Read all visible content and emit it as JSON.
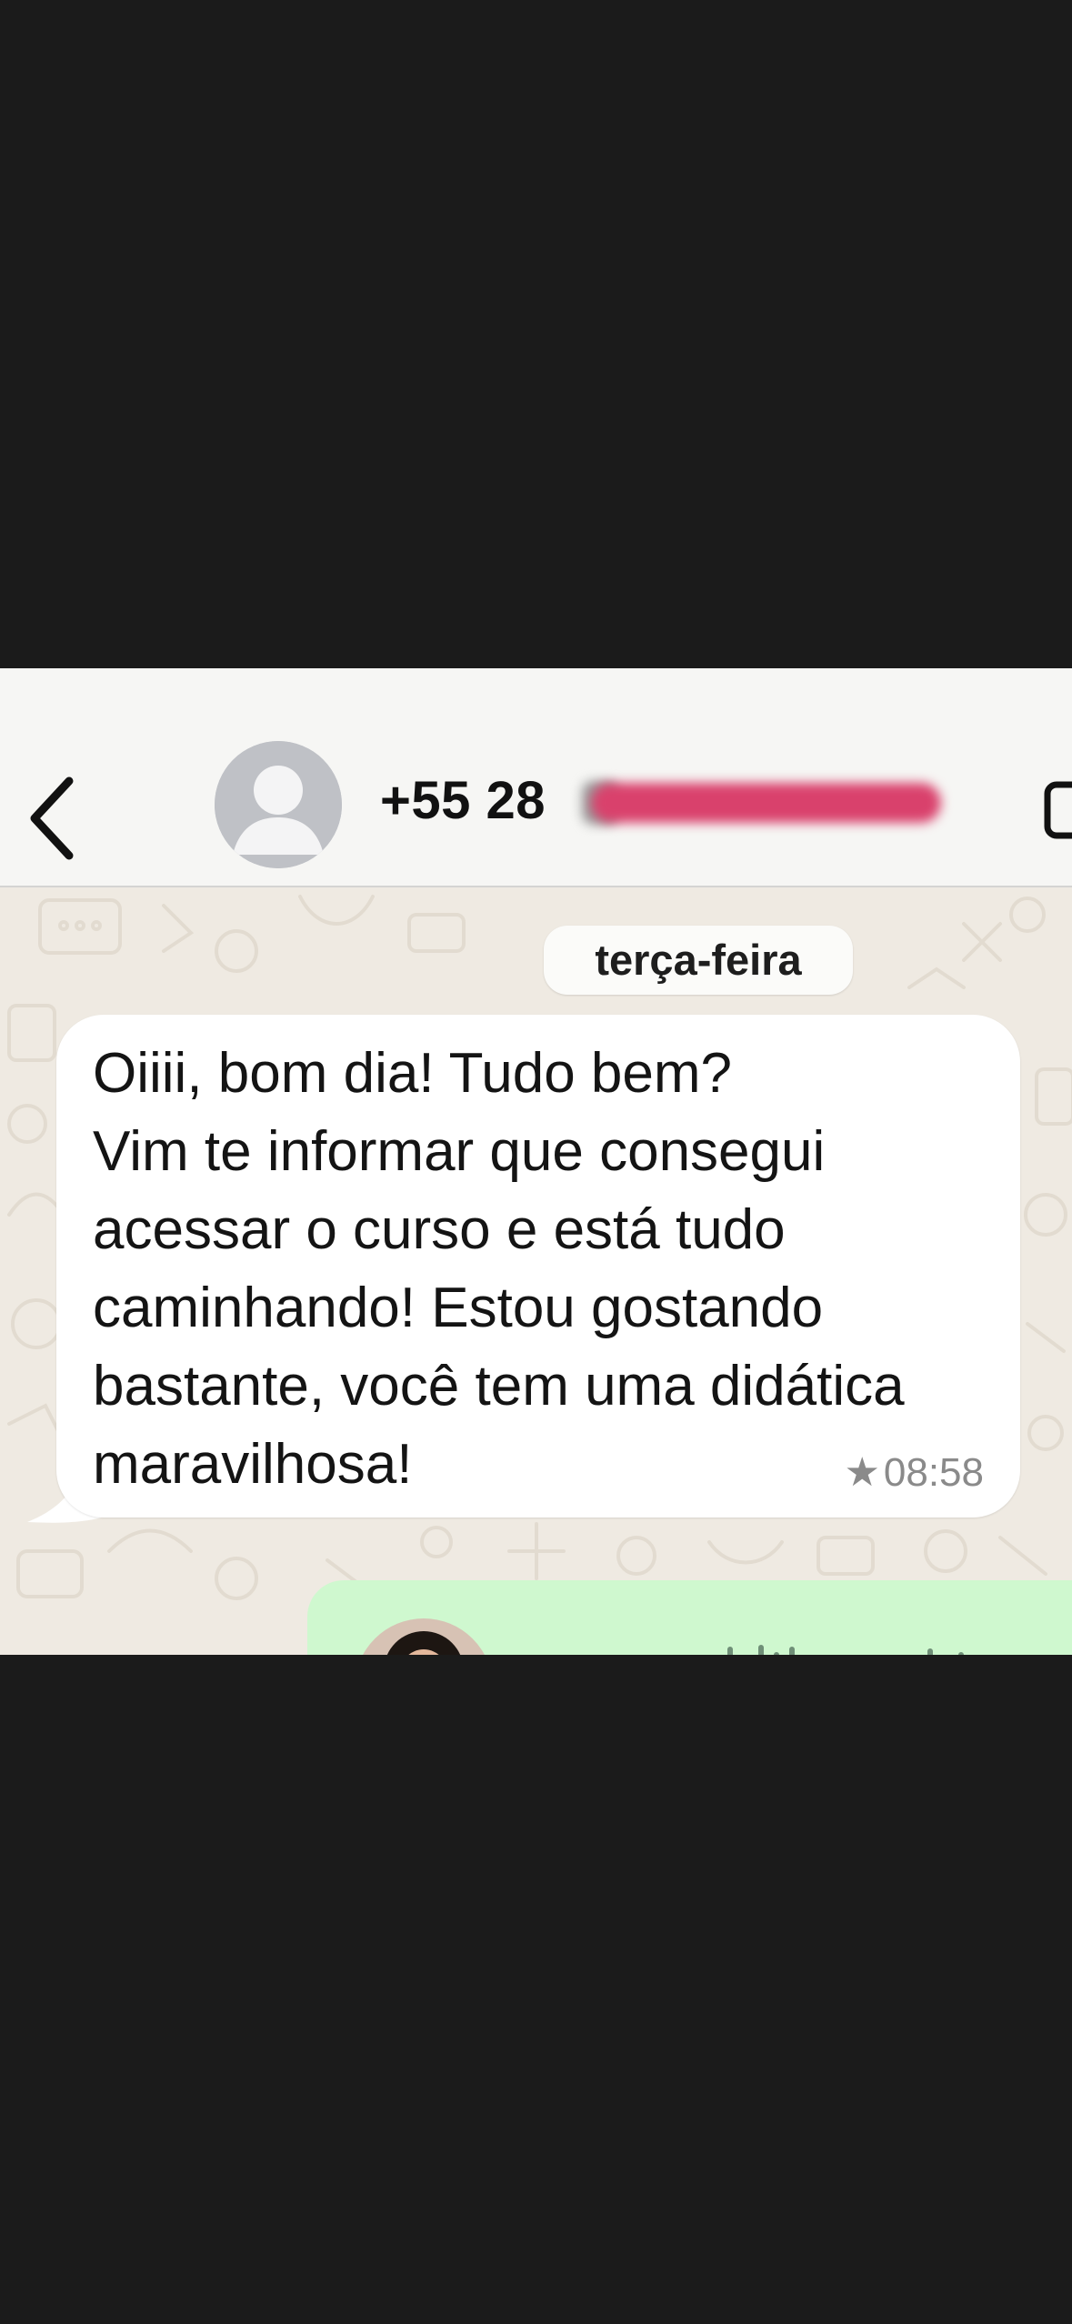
{
  "header": {
    "back_icon": "chevron-left-icon",
    "avatar_icon": "default-contact-avatar",
    "phone_number": "+55 28",
    "video_icon": "video-call-icon"
  },
  "chat": {
    "date_separator": "terça-feira",
    "message": {
      "text": "Oiiii, bom dia! Tudo bem?\nVim te informar que consegui\nacessar o curso e está tudo\ncaminhando! Estou gostando\nbastante, você tem uma didática\nmaravilhosa!",
      "starred_icon": "star-icon",
      "time": "08:58"
    },
    "audio_message": {
      "avatar": "sender-photo",
      "waveform_icon": "audio-waveform"
    }
  },
  "colors": {
    "header_bg": "#f6f6f4",
    "chat_bg": "#efeae2",
    "incoming_bubble": "#ffffff",
    "outgoing_bubble": "#cff8cf",
    "redaction": "#d9416c"
  }
}
